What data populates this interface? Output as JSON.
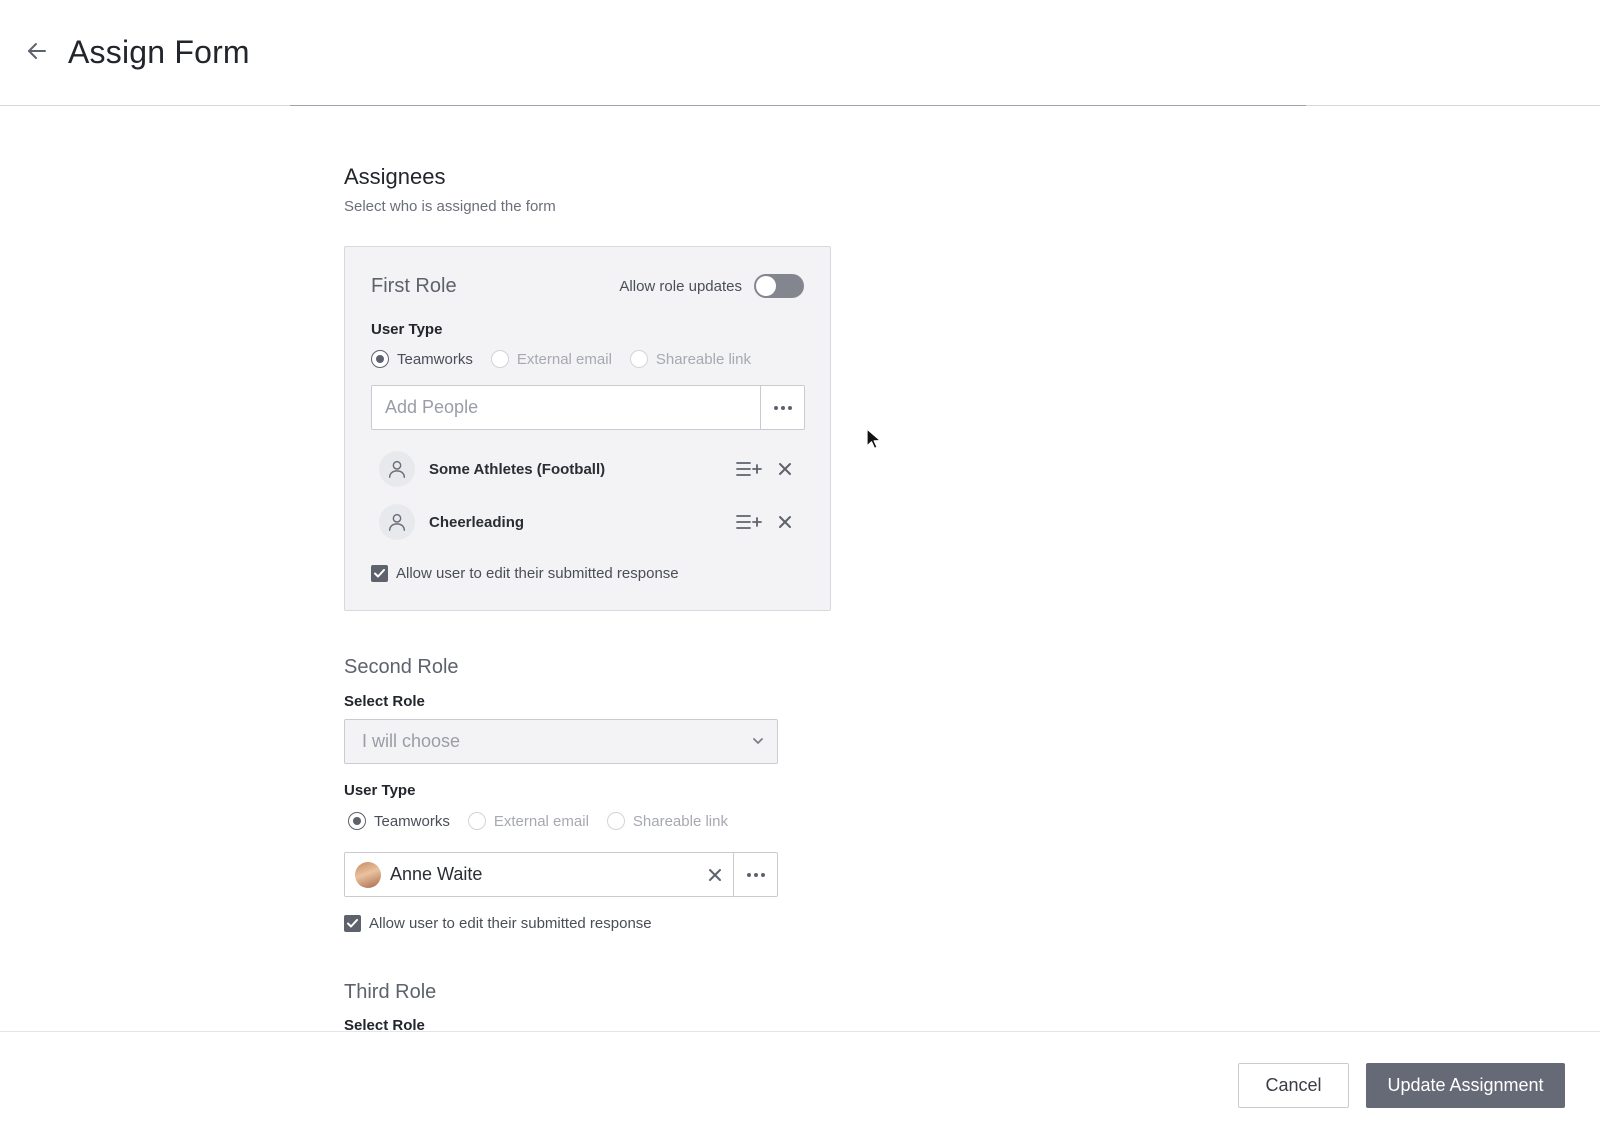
{
  "header": {
    "title": "Assign Form",
    "back_icon": "arrow-left-icon"
  },
  "assignees": {
    "title": "Assignees",
    "subtitle": "Select who is assigned the form"
  },
  "first_role": {
    "title": "First Role",
    "allow_updates_label": "Allow role updates",
    "allow_updates_on": false,
    "user_type_label": "User Type",
    "user_types": [
      "Teamworks",
      "External email",
      "Shareable link"
    ],
    "selected_user_type": "Teamworks",
    "add_people_placeholder": "Add People",
    "assignees": [
      {
        "name": "Some Athletes (Football)"
      },
      {
        "name": "Cheerleading"
      }
    ],
    "allow_edit_label": "Allow user to edit their submitted response",
    "allow_edit_checked": true
  },
  "second_role": {
    "title": "Second Role",
    "select_role_label": "Select Role",
    "select_role_value": "I will choose",
    "user_type_label": "User Type",
    "user_types": [
      "Teamworks",
      "External email",
      "Shareable link"
    ],
    "selected_user_type": "Teamworks",
    "selected_person": "Anne Waite",
    "allow_edit_label": "Allow user to edit their submitted response",
    "allow_edit_checked": true
  },
  "third_role": {
    "title": "Third Role",
    "select_role_label": "Select Role"
  },
  "footer": {
    "cancel_label": "Cancel",
    "update_label": "Update Assignment"
  },
  "colors": {
    "primary_button": "#666a76",
    "card_background": "#f3f3f5",
    "toggle_off": "#83868f"
  }
}
